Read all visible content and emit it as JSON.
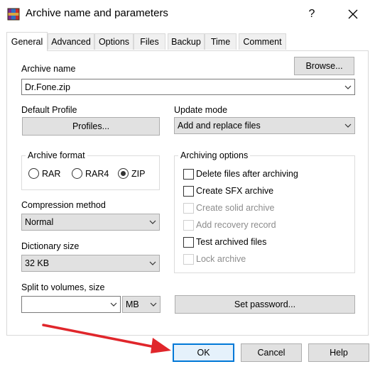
{
  "window": {
    "title": "Archive name and parameters",
    "help_glyph": "?",
    "close_glyph": "×"
  },
  "tabs": [
    {
      "label": "General",
      "active": true
    },
    {
      "label": "Advanced"
    },
    {
      "label": "Options"
    },
    {
      "label": "Files"
    },
    {
      "label": "Backup"
    },
    {
      "label": "Time"
    },
    {
      "label": "Comment"
    }
  ],
  "general": {
    "archive_name_label": "Archive name",
    "browse_label": "Browse...",
    "archive_name_value": "Dr.Fone.zip",
    "default_profile_label": "Default Profile",
    "profiles_label": "Profiles...",
    "update_mode_label": "Update mode",
    "update_mode_value": "Add and replace files",
    "archive_format_label": "Archive format",
    "formats": [
      {
        "label": "RAR",
        "selected": false
      },
      {
        "label": "RAR4",
        "selected": false
      },
      {
        "label": "ZIP",
        "selected": true
      }
    ],
    "compression_label": "Compression method",
    "compression_value": "Normal",
    "dictionary_label": "Dictionary size",
    "dictionary_value": "32 KB",
    "split_label": "Split to volumes, size",
    "split_value": "",
    "split_unit": "MB",
    "set_password_label": "Set password...",
    "archiving_options_label": "Archiving options",
    "options": [
      {
        "label": "Delete files after archiving",
        "checked": false,
        "enabled": true
      },
      {
        "label": "Create SFX archive",
        "checked": false,
        "enabled": true
      },
      {
        "label": "Create solid archive",
        "checked": false,
        "enabled": false
      },
      {
        "label": "Add recovery record",
        "checked": false,
        "enabled": false
      },
      {
        "label": "Test archived files",
        "checked": false,
        "enabled": true
      },
      {
        "label": "Lock archive",
        "checked": false,
        "enabled": false
      }
    ]
  },
  "footer": {
    "ok": "OK",
    "cancel": "Cancel",
    "help": "Help"
  },
  "colors": {
    "accent": "#0078d7",
    "annotation_arrow": "#e0262b"
  }
}
